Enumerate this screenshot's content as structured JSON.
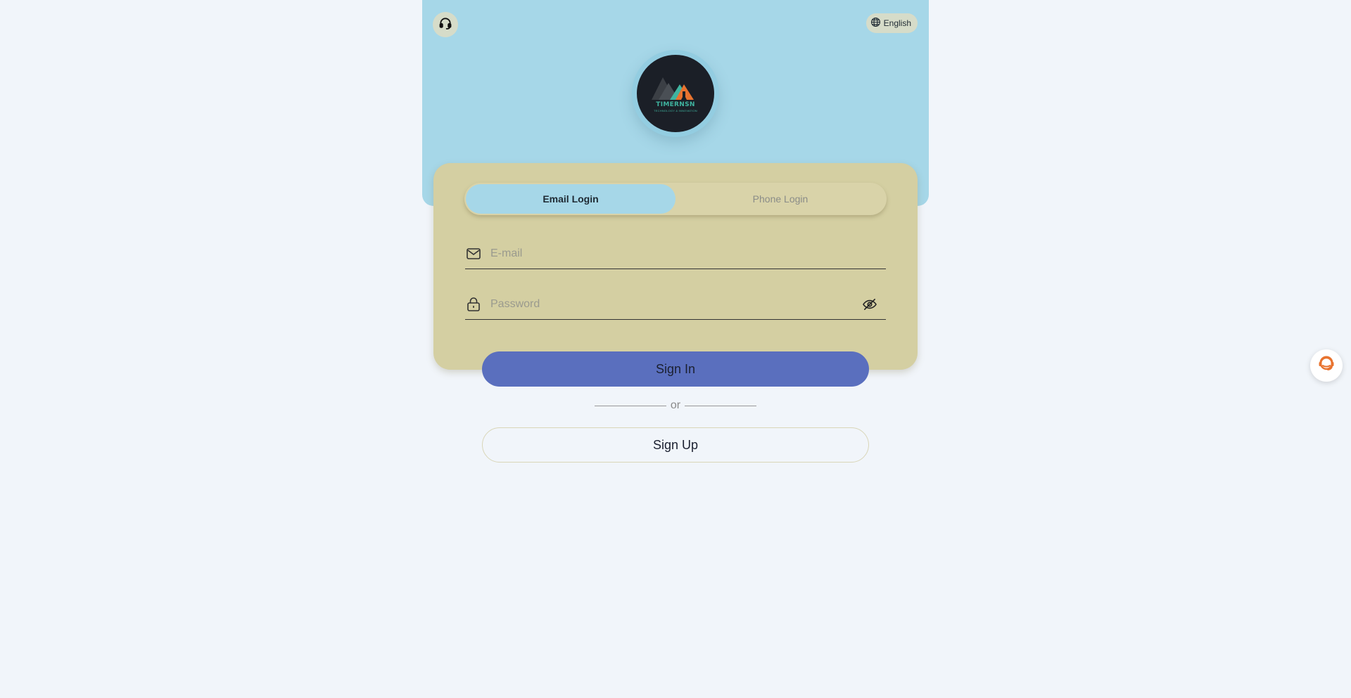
{
  "header": {
    "support_icon": "headset-icon",
    "language": {
      "icon": "globe-icon",
      "label": "English"
    }
  },
  "logo": {
    "name": "TIMERNSN",
    "tagline": "TECHNOLOGY & INNOVATION"
  },
  "login": {
    "tabs": [
      {
        "label": "Email Login",
        "active": true
      },
      {
        "label": "Phone Login",
        "active": false
      }
    ],
    "email": {
      "icon": "envelope-icon",
      "value": "",
      "placeholder": "E-mail"
    },
    "password": {
      "icon": "lock-icon",
      "value": "",
      "placeholder": "Password",
      "toggle_icon": "eye-off-icon"
    },
    "signin_label": "Sign In",
    "or_label": "or",
    "signup_label": "Sign Up"
  },
  "floating": {
    "chat_icon": "chat-support-icon"
  },
  "colors": {
    "hero": "#a6d7e8",
    "card": "#d4cfa2",
    "primary": "#5a6fbe",
    "background": "#f1f5fa",
    "accent_orange": "#e8732f"
  }
}
